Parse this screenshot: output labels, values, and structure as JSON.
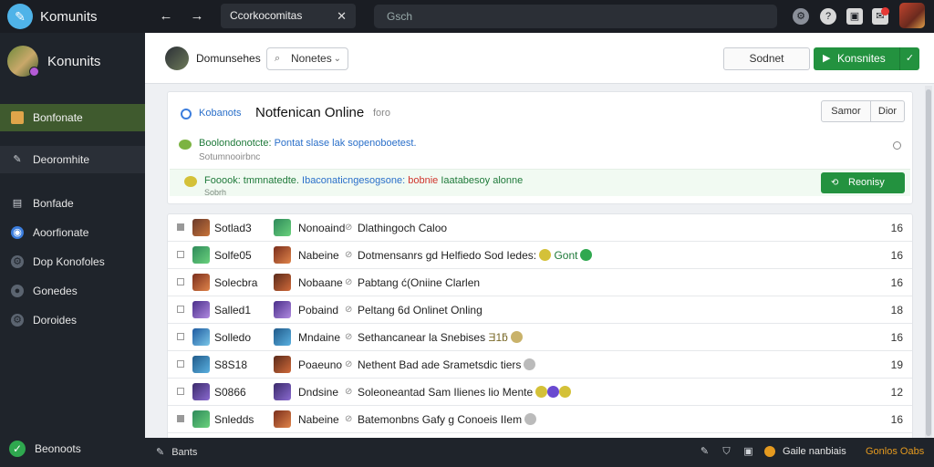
{
  "app": {
    "brand": "Komunits"
  },
  "topbar": {
    "tab_label": "Ccorkocomitas",
    "search_placeholder": "Gsch"
  },
  "sidebar": {
    "profile_name": "Konunits",
    "items": [
      {
        "label": "Bonfonate",
        "icon": "envelope-icon"
      },
      {
        "label": "Deoromhite",
        "icon": "pencil-icon"
      },
      {
        "label": "Bonfade",
        "icon": "folder-icon"
      },
      {
        "label": "Aoorfionate",
        "icon": "globe-icon"
      },
      {
        "label": "Dop Konofoles",
        "icon": "gear-icon"
      },
      {
        "label": "Gonedes",
        "icon": "chat-icon"
      },
      {
        "label": "Doroides",
        "icon": "gear-icon"
      }
    ],
    "bottom_label": "Beonoots"
  },
  "subheader": {
    "title": "Domunsehes",
    "dropdown_value": "Nonetes",
    "outline_button": "Sodnet",
    "green_button": "Konsnites"
  },
  "notice": {
    "link": "Kobanots",
    "separator": "·",
    "title": "Notfenican Online",
    "count": "foro",
    "seg_left": "Samor",
    "seg_right": "Dior",
    "row1_green": "Boolondonotcte:",
    "row1_blue": "Pontat slase lak sopenoboetest.",
    "row1_sub": "Sotumnooirbnc",
    "row2_green": "Fooook: tmmnatedte.",
    "row2_blue": "Ibaconaticngesogsone:",
    "row2_red": "bobnie",
    "row2_green2": "Iaatabesoy alonne",
    "row2_sub": "Sobrh",
    "row2_button": "Reonisy"
  },
  "list": {
    "rows": [
      {
        "group": "Sotlad3",
        "name": "Nonoaind",
        "message": "Dlathingoch Caloo",
        "emoji": [],
        "count": "16"
      },
      {
        "group": "Solfe05",
        "name": "Nabeine",
        "message": "Dotmensanrs gd Helfiedo Sod Iedes:",
        "emoji": [
          "#d4c138",
          "#2fa84f"
        ],
        "extra": "Gont",
        "count": "16"
      },
      {
        "group": "Solecbra",
        "name": "Nobaane",
        "message": "Pabtang ć(Oniine Clarlen",
        "emoji": [],
        "count": "16"
      },
      {
        "group": "Salled1",
        "name": "Pobaind",
        "message": "Peltang 6d Onlinet Onling",
        "emoji": [],
        "count": "18"
      },
      {
        "group": "Solledo",
        "name": "Mndaine",
        "message": "Sethancanear la Snebises",
        "emoji": [
          "#c9b26a",
          "#c9b26a"
        ],
        "extra": "Ǝ1ƃ",
        "count": "16"
      },
      {
        "group": "S8S18",
        "name": "Poaeuno",
        "message": "Nethent Bad ade Srametsdic tiers",
        "emoji": [
          "#bbbbbb"
        ],
        "count": "19"
      },
      {
        "group": "S0866",
        "name": "Dndsine",
        "message": "Soleoneantad Sam Ilienes lio Mente",
        "emoji": [
          "#d4c138",
          "#6a4ad0",
          "#d4c138"
        ],
        "count": "12"
      },
      {
        "group": "Snledds",
        "name": "Nabeine",
        "message": "Batemonbns Gafy g Conoeis IIem",
        "emoji": [
          "#bbbbbb"
        ],
        "count": "16"
      }
    ]
  },
  "bottombar": {
    "left_label": "Bants",
    "coin_label": "Gaile nanbiais",
    "orange_label": "Gonlos Oabs"
  },
  "colors": {
    "accent_green": "#23923f",
    "sidebar_active": "#3f5a2e",
    "link_blue": "#2a6fc9",
    "coin_orange": "#e59a1f",
    "alert_red": "#d0342c"
  }
}
